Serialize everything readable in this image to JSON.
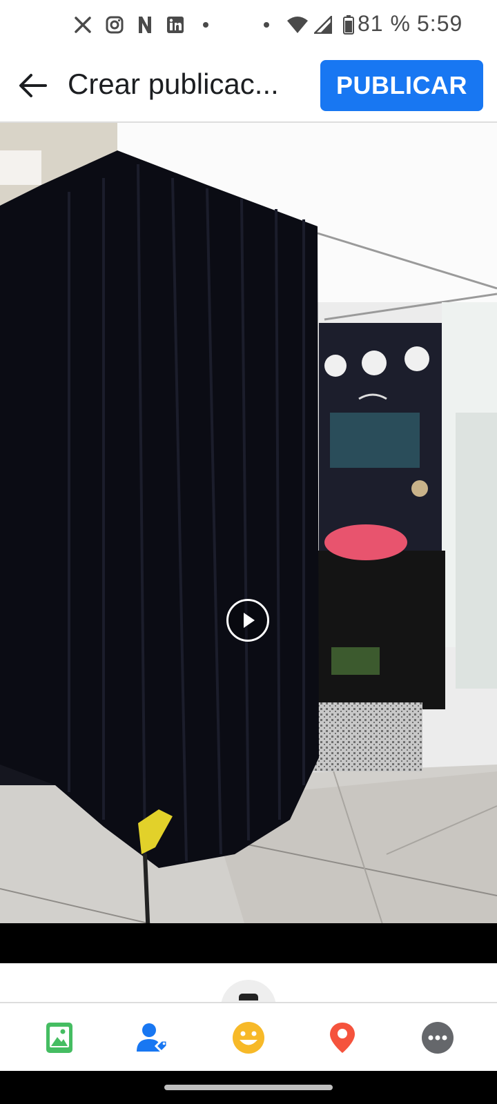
{
  "status_bar": {
    "icons": [
      "x-icon",
      "instagram-icon",
      "netflix-icon",
      "linkedin-icon",
      "dot-icon",
      "dot-icon",
      "wifi-icon",
      "signal-icon",
      "battery-icon"
    ],
    "battery": "81 %",
    "time": "5:59"
  },
  "header": {
    "title": "Crear publicac...",
    "publish_label": "PUBLICAR"
  },
  "media": {
    "type": "video",
    "play_icon": "play-icon"
  },
  "toolbar": {
    "items": [
      {
        "name": "photo-video",
        "icon": "photo-icon",
        "color": "#45bd62"
      },
      {
        "name": "tag-people",
        "icon": "tag-people-icon",
        "color": "#1877f2"
      },
      {
        "name": "feeling-activity",
        "icon": "smiley-icon",
        "color": "#f7b928"
      },
      {
        "name": "check-in",
        "icon": "location-pin-icon",
        "color": "#f5533d"
      },
      {
        "name": "more",
        "icon": "more-icon",
        "color": "#65676b"
      }
    ]
  },
  "colors": {
    "accent": "#1877f2",
    "text": "#1c1e21",
    "divider": "#dddddd"
  }
}
